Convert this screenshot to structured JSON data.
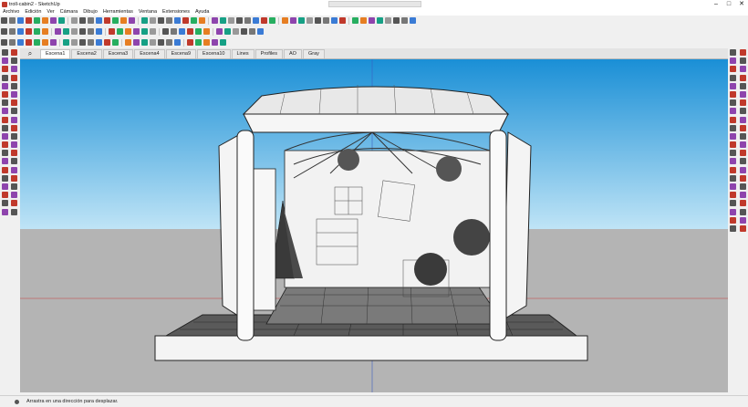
{
  "window": {
    "title": "troll-cabin2 - SketchUp"
  },
  "menu": [
    "Archivo",
    "Edición",
    "Ver",
    "Cámara",
    "Dibujo",
    "Herramientas",
    "Ventana",
    "Extensiones",
    "Ayuda"
  ],
  "scene_tabs": [
    "Escena1",
    "Escena2",
    "Escena3",
    "Escena4",
    "Escena9",
    "Escena10",
    "Lines",
    "Profiles",
    "AO",
    "Gray"
  ],
  "active_tab": "Escena1",
  "status": {
    "text": "Arrastra en una dirección para desplazar."
  },
  "colors": {
    "sky_top": "#1a8fd6",
    "sky_bottom": "#bfe4f6",
    "ground": "#b4b4b4",
    "axis_red": "#c23b3b",
    "axis_blue": "#3b5fc2"
  },
  "icons": {
    "toolbar_row1": [
      "select-icon",
      "eraser-icon",
      "line-icon",
      "arc-icon",
      "rectangle-icon",
      "circle-icon",
      "polygon-icon",
      "push-pull-icon",
      "move-icon",
      "rotate-icon",
      "scale-icon",
      "offset-icon",
      "tape-icon",
      "dimension-icon",
      "protractor-icon",
      "text-icon",
      "axes-icon",
      "3d-text-icon",
      "paint-icon",
      "orbit-icon",
      "pan-icon",
      "zoom-icon",
      "zoom-extents-icon",
      "section-icon",
      "component-icon",
      "group-icon",
      "warehouse-icon",
      "extension-icon",
      "solid-icon",
      "sandbox-icon",
      "camera-icon",
      "walk-icon",
      "look-icon",
      "layers-icon",
      "style-icon",
      "shadow-icon",
      "fog-icon",
      "match-photo-icon",
      "scenes-icon",
      "outliner-icon",
      "model-info-icon",
      "preferences-icon",
      "ruby-icon",
      "render-icon",
      "vray-icon",
      "material-icon",
      "light-icon",
      "texture-icon"
    ],
    "toolbar_row2": [
      "iso-view-icon",
      "top-view-icon",
      "front-view-icon",
      "right-view-icon",
      "back-view-icon",
      "left-view-icon",
      "xray-icon",
      "back-edges-icon",
      "wireframe-icon",
      "hidden-line-icon",
      "shaded-icon",
      "textured-icon",
      "monochrome-icon",
      "perspective-icon",
      "parallel-icon",
      "two-point-icon",
      "section-plane-icon",
      "section-cut-icon",
      "section-fill-icon",
      "display-sections-icon",
      "tag-icon",
      "outline-icon",
      "fix-icon",
      "weld-icon",
      "join-icon",
      "split-icon",
      "trim-icon",
      "intersect-icon",
      "union-icon",
      "subtract-icon"
    ],
    "toolbar_row3": [
      "follow-me-icon",
      "flip-icon",
      "mirror-icon",
      "array-icon",
      "align-icon",
      "distribute-icon",
      "snap-icon",
      "grid-icon",
      "guide-icon",
      "point-icon",
      "hide-icon",
      "unhide-icon",
      "lock-icon",
      "unlock-icon",
      "explode-icon",
      "make-unique-icon",
      "edit-icon",
      "close-group-icon",
      "previous-icon",
      "next-icon",
      "undo-icon",
      "redo-icon",
      "cut-icon",
      "copy-icon",
      "paste-icon",
      "delete-icon"
    ]
  }
}
